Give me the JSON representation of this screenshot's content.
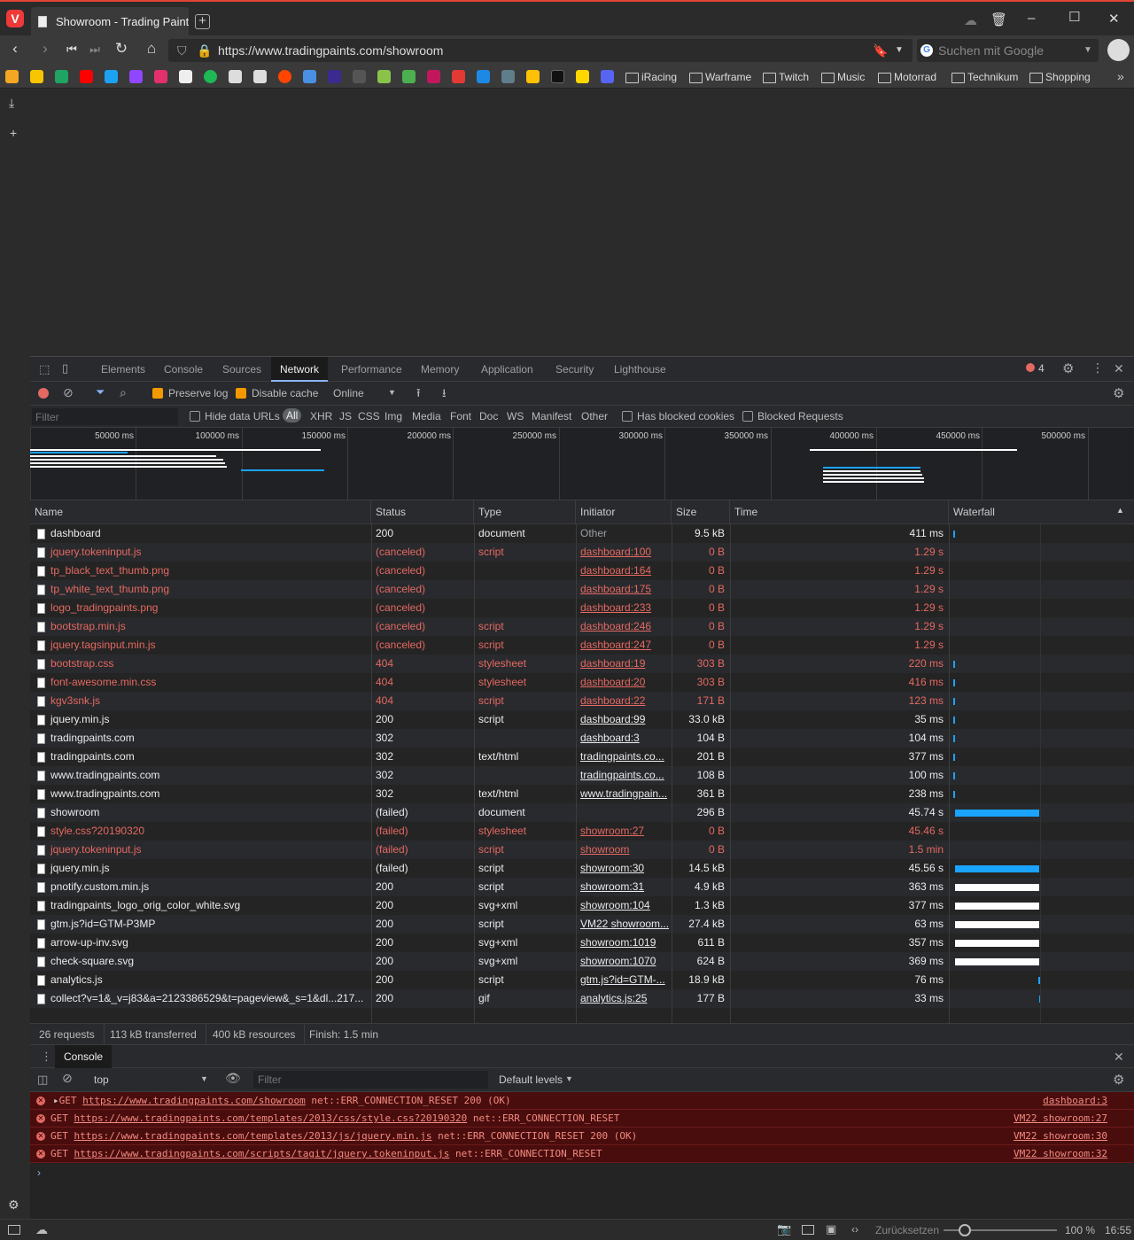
{
  "browser": {
    "tab_title": "Showroom - Trading Paints",
    "url": "https://www.tradingpaints.com/showroom",
    "search_placeholder": "Suchen mit Google",
    "bookmark_folders": [
      "iRacing",
      "Warframe",
      "Twitch",
      "Music",
      "Motorrad",
      "Technikum",
      "Shopping"
    ]
  },
  "devtools": {
    "tabs": [
      "Elements",
      "Console",
      "Sources",
      "Network",
      "Performance",
      "Memory",
      "Application",
      "Security",
      "Lighthouse"
    ],
    "active_tab": "Network",
    "error_count": "4",
    "toolbar": {
      "preserve_log": "Preserve log",
      "disable_cache": "Disable cache",
      "throttle": "Online"
    },
    "filter": {
      "placeholder": "Filter",
      "hide_data_urls": "Hide data URLs",
      "all": "All",
      "types": [
        "XHR",
        "JS",
        "CSS",
        "Img",
        "Media",
        "Font",
        "Doc",
        "WS",
        "Manifest",
        "Other"
      ],
      "has_blocked_cookies": "Has blocked cookies",
      "blocked_requests": "Blocked Requests"
    },
    "overview_ticks": [
      "50000 ms",
      "100000 ms",
      "150000 ms",
      "200000 ms",
      "250000 ms",
      "300000 ms",
      "350000 ms",
      "400000 ms",
      "450000 ms",
      "500000 ms"
    ],
    "columns": [
      "Name",
      "Status",
      "Type",
      "Initiator",
      "Size",
      "Time",
      "Waterfall"
    ],
    "requests": [
      {
        "name": "dashboard",
        "status": "200",
        "type": "document",
        "initiator": "Other",
        "size": "9.5 kB",
        "time": "411 ms",
        "err": false
      },
      {
        "name": "jquery.tokeninput.js",
        "status": "(canceled)",
        "type": "script",
        "initiator": "dashboard:100",
        "size": "0 B",
        "time": "1.29 s",
        "err": true
      },
      {
        "name": "tp_black_text_thumb.png",
        "status": "(canceled)",
        "type": "",
        "initiator": "dashboard:164",
        "size": "0 B",
        "time": "1.29 s",
        "err": true
      },
      {
        "name": "tp_white_text_thumb.png",
        "status": "(canceled)",
        "type": "",
        "initiator": "dashboard:175",
        "size": "0 B",
        "time": "1.29 s",
        "err": true
      },
      {
        "name": "logo_tradingpaints.png",
        "status": "(canceled)",
        "type": "",
        "initiator": "dashboard:233",
        "size": "0 B",
        "time": "1.29 s",
        "err": true
      },
      {
        "name": "bootstrap.min.js",
        "status": "(canceled)",
        "type": "script",
        "initiator": "dashboard:246",
        "size": "0 B",
        "time": "1.29 s",
        "err": true
      },
      {
        "name": "jquery.tagsinput.min.js",
        "status": "(canceled)",
        "type": "script",
        "initiator": "dashboard:247",
        "size": "0 B",
        "time": "1.29 s",
        "err": true
      },
      {
        "name": "bootstrap.css",
        "status": "404",
        "type": "stylesheet",
        "initiator": "dashboard:19",
        "size": "303 B",
        "time": "220 ms",
        "err": true
      },
      {
        "name": "font-awesome.min.css",
        "status": "404",
        "type": "stylesheet",
        "initiator": "dashboard:20",
        "size": "303 B",
        "time": "416 ms",
        "err": true
      },
      {
        "name": "kgv3snk.js",
        "status": "404",
        "type": "script",
        "initiator": "dashboard:22",
        "size": "171 B",
        "time": "123 ms",
        "err": true
      },
      {
        "name": "jquery.min.js",
        "status": "200",
        "type": "script",
        "initiator": "dashboard:99",
        "size": "33.0 kB",
        "time": "35 ms",
        "err": false
      },
      {
        "name": "tradingpaints.com",
        "status": "302",
        "type": "",
        "initiator": "dashboard:3",
        "size": "104 B",
        "time": "104 ms",
        "err": false
      },
      {
        "name": "tradingpaints.com",
        "status": "302",
        "type": "text/html",
        "initiator": "tradingpaints.co...",
        "size": "201 B",
        "time": "377 ms",
        "err": false
      },
      {
        "name": "www.tradingpaints.com",
        "status": "302",
        "type": "",
        "initiator": "tradingpaints.co...",
        "size": "108 B",
        "time": "100 ms",
        "err": false
      },
      {
        "name": "www.tradingpaints.com",
        "status": "302",
        "type": "text/html",
        "initiator": "www.tradingpain...",
        "size": "361 B",
        "time": "238 ms",
        "err": false
      },
      {
        "name": "showroom",
        "status": "(failed)",
        "type": "document",
        "initiator": "",
        "size": "296 B",
        "time": "45.74 s",
        "err": false
      },
      {
        "name": "style.css?20190320",
        "status": "(failed)",
        "type": "stylesheet",
        "initiator": "showroom:27",
        "size": "0 B",
        "time": "45.46 s",
        "err": true
      },
      {
        "name": "jquery.tokeninput.js",
        "status": "(failed)",
        "type": "script",
        "initiator": "showroom",
        "size": "0 B",
        "time": "1.5 min",
        "err": true
      },
      {
        "name": "jquery.min.js",
        "status": "(failed)",
        "type": "script",
        "initiator": "showroom:30",
        "size": "14.5 kB",
        "time": "45.56 s",
        "err": false
      },
      {
        "name": "pnotify.custom.min.js",
        "status": "200",
        "type": "script",
        "initiator": "showroom:31",
        "size": "4.9 kB",
        "time": "363 ms",
        "err": false
      },
      {
        "name": "tradingpaints_logo_orig_color_white.svg",
        "status": "200",
        "type": "svg+xml",
        "initiator": "showroom:104",
        "size": "1.3 kB",
        "time": "377 ms",
        "err": false
      },
      {
        "name": "gtm.js?id=GTM-P3MP",
        "status": "200",
        "type": "script",
        "initiator": "VM22 showroom...",
        "size": "27.4 kB",
        "time": "63 ms",
        "err": false
      },
      {
        "name": "arrow-up-inv.svg",
        "status": "200",
        "type": "svg+xml",
        "initiator": "showroom:1019",
        "size": "611 B",
        "time": "357 ms",
        "err": false
      },
      {
        "name": "check-square.svg",
        "status": "200",
        "type": "svg+xml",
        "initiator": "showroom:1070",
        "size": "624 B",
        "time": "369 ms",
        "err": false
      },
      {
        "name": "analytics.js",
        "status": "200",
        "type": "script",
        "initiator": "gtm.js?id=GTM-...",
        "size": "18.9 kB",
        "time": "76 ms",
        "err": false
      },
      {
        "name": "collect?v=1&_v=j83&a=2123386529&t=pageview&_s=1&dl...217...",
        "status": "200",
        "type": "gif",
        "initiator": "analytics.js:25",
        "size": "177 B",
        "time": "33 ms",
        "err": false
      }
    ],
    "waterfall": [
      {
        "start": 0.0,
        "len": 0.01,
        "color": "#1aa3ff"
      },
      {},
      {},
      {},
      {},
      {},
      {},
      {
        "start": 0.0,
        "len": 0.01,
        "color": "#1aa3ff"
      },
      {
        "start": 0.0,
        "len": 0.01,
        "color": "#1aa3ff"
      },
      {
        "start": 0.0,
        "len": 0.01,
        "color": "#1aa3ff"
      },
      {
        "start": 0.0,
        "len": 0.01,
        "color": "#1aa3ff"
      },
      {
        "start": 0.0,
        "len": 0.01,
        "color": "#1aa3ff"
      },
      {
        "start": 0.0,
        "len": 0.01,
        "color": "#1aa3ff"
      },
      {
        "start": 0.0,
        "len": 0.01,
        "color": "#1aa3ff"
      },
      {
        "start": 0.0,
        "len": 0.01,
        "color": "#1aa3ff"
      },
      {
        "start": 0.02,
        "len": 0.95,
        "color": "#1aa3ff"
      },
      {},
      {},
      {
        "start": 0.02,
        "len": 0.95,
        "color": "#1aa3ff"
      },
      {
        "start": 0.02,
        "len": 0.95,
        "color": "#ffffff"
      },
      {
        "start": 0.02,
        "len": 0.95,
        "color": "#ffffff"
      },
      {
        "start": 0.02,
        "len": 0.95,
        "color": "#ffffff"
      },
      {
        "start": 0.02,
        "len": 0.95,
        "color": "#ffffff"
      },
      {
        "start": 0.02,
        "len": 0.95,
        "color": "#ffffff"
      },
      {
        "start": 0.96,
        "len": 0.01,
        "color": "#1aa3ff"
      },
      {
        "start": 0.97,
        "len": 0.01,
        "color": "#1aa3ff"
      }
    ],
    "summary": {
      "requests": "26 requests",
      "transferred": "113 kB transferred",
      "resources": "400 kB resources",
      "finish": "Finish: 1.5 min"
    },
    "console": {
      "drawer_tab": "Console",
      "context": "top",
      "filter_placeholder": "Filter",
      "levels": "Default levels",
      "messages": [
        {
          "method": "GET",
          "url": "https://www.tradingpaints.com/showroom",
          "error": "net::ERR_CONNECTION_RESET 200 (OK)",
          "source": "dashboard:3",
          "expand": true
        },
        {
          "method": "GET",
          "url": "https://www.tradingpaints.com/templates/2013/css/style.css?20190320",
          "error": "net::ERR_CONNECTION_RESET",
          "source": "VM22 showroom:27",
          "expand": false
        },
        {
          "method": "GET",
          "url": "https://www.tradingpaints.com/templates/2013/js/jquery.min.js",
          "error": "net::ERR_CONNECTION_RESET 200 (OK)",
          "source": "VM22 showroom:30",
          "expand": false
        },
        {
          "method": "GET",
          "url": "https://www.tradingpaints.com/scripts/tagit/jquery.tokeninput.js",
          "error": "net::ERR_CONNECTION_RESET",
          "source": "VM22 showroom:32",
          "expand": false
        }
      ]
    }
  },
  "statusbar": {
    "reset": "Zurücksetzen",
    "zoom": "100 %",
    "clock": "16:55"
  }
}
